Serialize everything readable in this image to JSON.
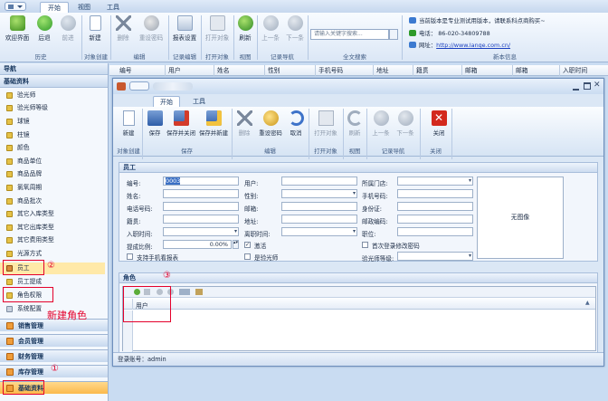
{
  "main_tabs": [
    "开始",
    "视图",
    "工具"
  ],
  "main_ribbon": {
    "buttons": [
      {
        "name": "welcome",
        "label": "欢迎界面"
      },
      {
        "name": "back",
        "label": "后退"
      },
      {
        "name": "forward",
        "label": "前进"
      },
      {
        "name": "new",
        "label": "新建"
      },
      {
        "name": "delete",
        "label": "删除"
      },
      {
        "name": "reset-password",
        "label": "重设密码"
      },
      {
        "name": "report-settings",
        "label": "报表设置"
      },
      {
        "name": "open-object",
        "label": "打开对象"
      },
      {
        "name": "refresh",
        "label": "刷新"
      },
      {
        "name": "prev",
        "label": "上一条"
      },
      {
        "name": "next",
        "label": "下一条"
      }
    ],
    "groups": [
      "历史",
      "对象创建",
      "编辑",
      "记录编辑",
      "打开对象",
      "视图",
      "记录导航",
      "全文搜索",
      "新本信息"
    ],
    "search_placeholder": "请输入关键字搜索..."
  },
  "info": {
    "notice": "当前版本是专业测试用版本，请联系科点商购买~",
    "phone": "电话：  86-020-34809788",
    "website_label": "网址：",
    "website": "http://www.lanqe.com.cn/"
  },
  "sidebar": {
    "header": "导航",
    "section": "基础资料",
    "items": [
      "验光师",
      "验光师等级",
      "球镜",
      "柱镜",
      "颜色",
      "商品单位",
      "商品品牌",
      "氯氧周期",
      "商品批次",
      "其它入库类型",
      "其它出库类型",
      "其它费用类型",
      "光源方式",
      "员工",
      "员工提成",
      "角色权限",
      "系统配置"
    ],
    "bottom_tabs": [
      "销售管理",
      "会员管理",
      "财务管理",
      "库存管理",
      "基础资料"
    ]
  },
  "background_grid": {
    "columns": [
      "编号",
      "用户",
      "姓名",
      "性别",
      "手机号码",
      "地址",
      "籍贯",
      "邮箱",
      "入职时间"
    ]
  },
  "child_window": {
    "tabs": [
      "开始",
      "工具"
    ],
    "buttons": [
      {
        "name": "new",
        "label": "新建"
      },
      {
        "name": "save",
        "label": "保存"
      },
      {
        "name": "save-close",
        "label": "保存并关闭"
      },
      {
        "name": "save-new",
        "label": "保存并新建"
      },
      {
        "name": "delete",
        "label": "删除"
      },
      {
        "name": "reset-password",
        "label": "重设密码"
      },
      {
        "name": "cancel",
        "label": "取消"
      },
      {
        "name": "open-object",
        "label": "打开对象"
      },
      {
        "name": "refresh",
        "label": "刷新"
      },
      {
        "name": "prev",
        "label": "上一条"
      },
      {
        "name": "next",
        "label": "下一条"
      },
      {
        "name": "close",
        "label": "关闭"
      }
    ],
    "groups": [
      "对象创建",
      "保存",
      "编辑",
      "打开对象",
      "视图",
      "记录导航",
      "关闭"
    ],
    "employee_section": "员工",
    "form": {
      "code_label": "编号:",
      "code_value": "0003",
      "user_label": "用户:",
      "store_label": "所属门店:",
      "name_label": "姓名:",
      "gender_label": "性别:",
      "mobile_label": "手机号码:",
      "phone_label": "电话号码:",
      "email_label": "邮箱:",
      "id_label": "身份证:",
      "origin_label": "籍贯:",
      "address_label": "地址:",
      "zip_label": "邮政编码:",
      "hire_label": "入职时间:",
      "leave_label": "离职时间:",
      "position_label": "职位:",
      "commission_label": "提成比例:",
      "commission_value": "0.00%",
      "active_label": "激活",
      "first_login_label": "首次登录修改密码",
      "mobile_report_label": "支持手机看报表",
      "is_optometrist_label": "是验光师",
      "optometrist_level_label": "验光师等级:",
      "no_image": "无图像"
    },
    "roles_section": "角色",
    "roles_column": "用户",
    "status": "登录账号：admin"
  },
  "annotations": {
    "mark1": "①",
    "mark2": "②",
    "mark3": "③",
    "new_role": "新建角色"
  }
}
